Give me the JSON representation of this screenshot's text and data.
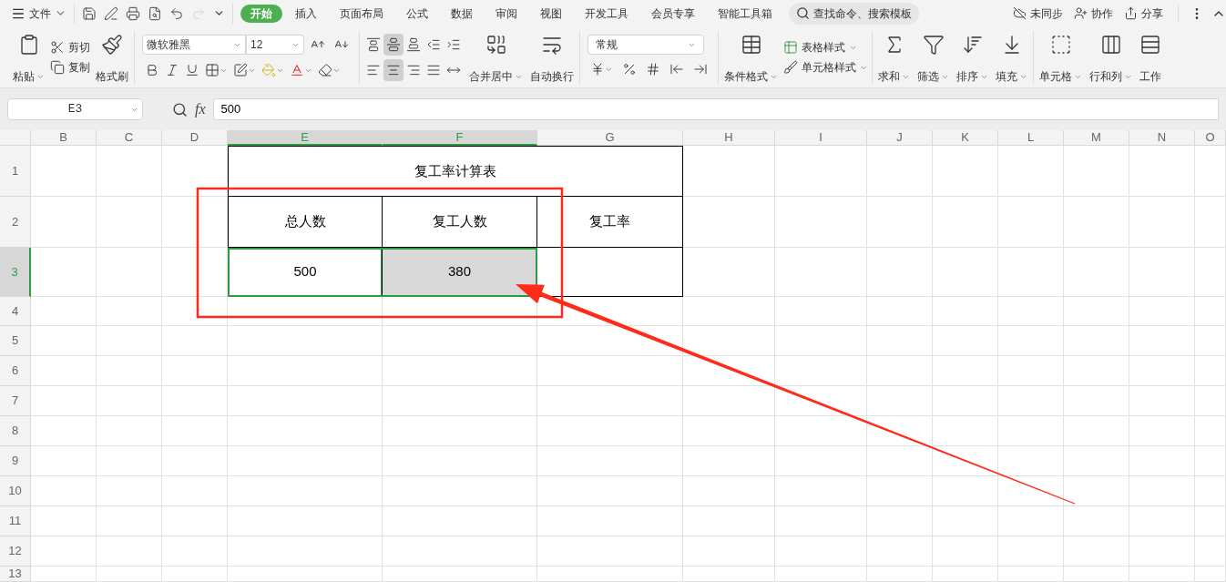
{
  "menu": {
    "file": "文件",
    "tabs": [
      {
        "label": "开始",
        "selected": true
      },
      {
        "label": "插入",
        "selected": false
      },
      {
        "label": "页面布局",
        "selected": false
      },
      {
        "label": "公式",
        "selected": false
      },
      {
        "label": "数据",
        "selected": false
      },
      {
        "label": "审阅",
        "selected": false
      },
      {
        "label": "视图",
        "selected": false
      },
      {
        "label": "开发工具",
        "selected": false
      },
      {
        "label": "会员专享",
        "selected": false
      },
      {
        "label": "智能工具箱",
        "selected": false
      }
    ],
    "search": {
      "placeholder": "查找命令、搜索模板"
    },
    "actions": [
      "未同步",
      "协作",
      "分享"
    ]
  },
  "ribbon": {
    "clipboard": {
      "paste": "粘贴",
      "cut": "剪切",
      "copy": "复制",
      "format_painter": "格式刷"
    },
    "font": {
      "name": "微软雅黑",
      "size": "12"
    },
    "alignment": {
      "vertical": [
        {
          "selected": false
        },
        {
          "selected": true
        },
        {
          "selected": false
        }
      ],
      "horizontal": [
        {
          "selected": false
        },
        {
          "selected": true
        },
        {
          "selected": false
        },
        {
          "selected": false
        }
      ],
      "merge": "合并居中",
      "wrap": "自动换行"
    },
    "number": {
      "format": "常规"
    },
    "styles": {
      "conditional": "条件格式",
      "table_style": "表格样式",
      "cell_style": "单元格样式"
    },
    "editing": [
      "求和",
      "筛选",
      "排序",
      "填充"
    ],
    "cells": [
      "单元格",
      "行和列",
      "工作"
    ]
  },
  "formula_bar": {
    "name_box": "E3",
    "fx": "fx",
    "value": "500"
  },
  "sheet": {
    "columns": [
      {
        "label": "B",
        "selected": false
      },
      {
        "label": "C",
        "selected": false
      },
      {
        "label": "D",
        "selected": false
      },
      {
        "label": "E",
        "selected": true
      },
      {
        "label": "F",
        "selected": true
      },
      {
        "label": "G",
        "selected": false
      },
      {
        "label": "H",
        "selected": false
      },
      {
        "label": "I",
        "selected": false
      },
      {
        "label": "J",
        "selected": false
      },
      {
        "label": "K",
        "selected": false
      },
      {
        "label": "L",
        "selected": false
      },
      {
        "label": "M",
        "selected": false
      },
      {
        "label": "N",
        "selected": false
      },
      {
        "label": "O",
        "selected": false
      }
    ],
    "rows": [
      {
        "label": "1",
        "selected": false
      },
      {
        "label": "2",
        "selected": false
      },
      {
        "label": "3",
        "selected": true
      },
      {
        "label": "4",
        "selected": false
      },
      {
        "label": "5",
        "selected": false
      },
      {
        "label": "6",
        "selected": false
      },
      {
        "label": "7",
        "selected": false
      },
      {
        "label": "8",
        "selected": false
      },
      {
        "label": "9",
        "selected": false
      },
      {
        "label": "10",
        "selected": false
      },
      {
        "label": "11",
        "selected": false
      },
      {
        "label": "12",
        "selected": false
      },
      {
        "label": "13",
        "selected": false
      }
    ],
    "table": {
      "title": "复工率计算表",
      "header": [
        "总人数",
        "复工人数",
        "复工率"
      ],
      "rows": [
        [
          {
            "text": "500",
            "selected": true,
            "active": true
          },
          {
            "text": "380",
            "selected": true,
            "active": false
          },
          {
            "selected": false,
            "active": false
          }
        ]
      ]
    }
  }
}
